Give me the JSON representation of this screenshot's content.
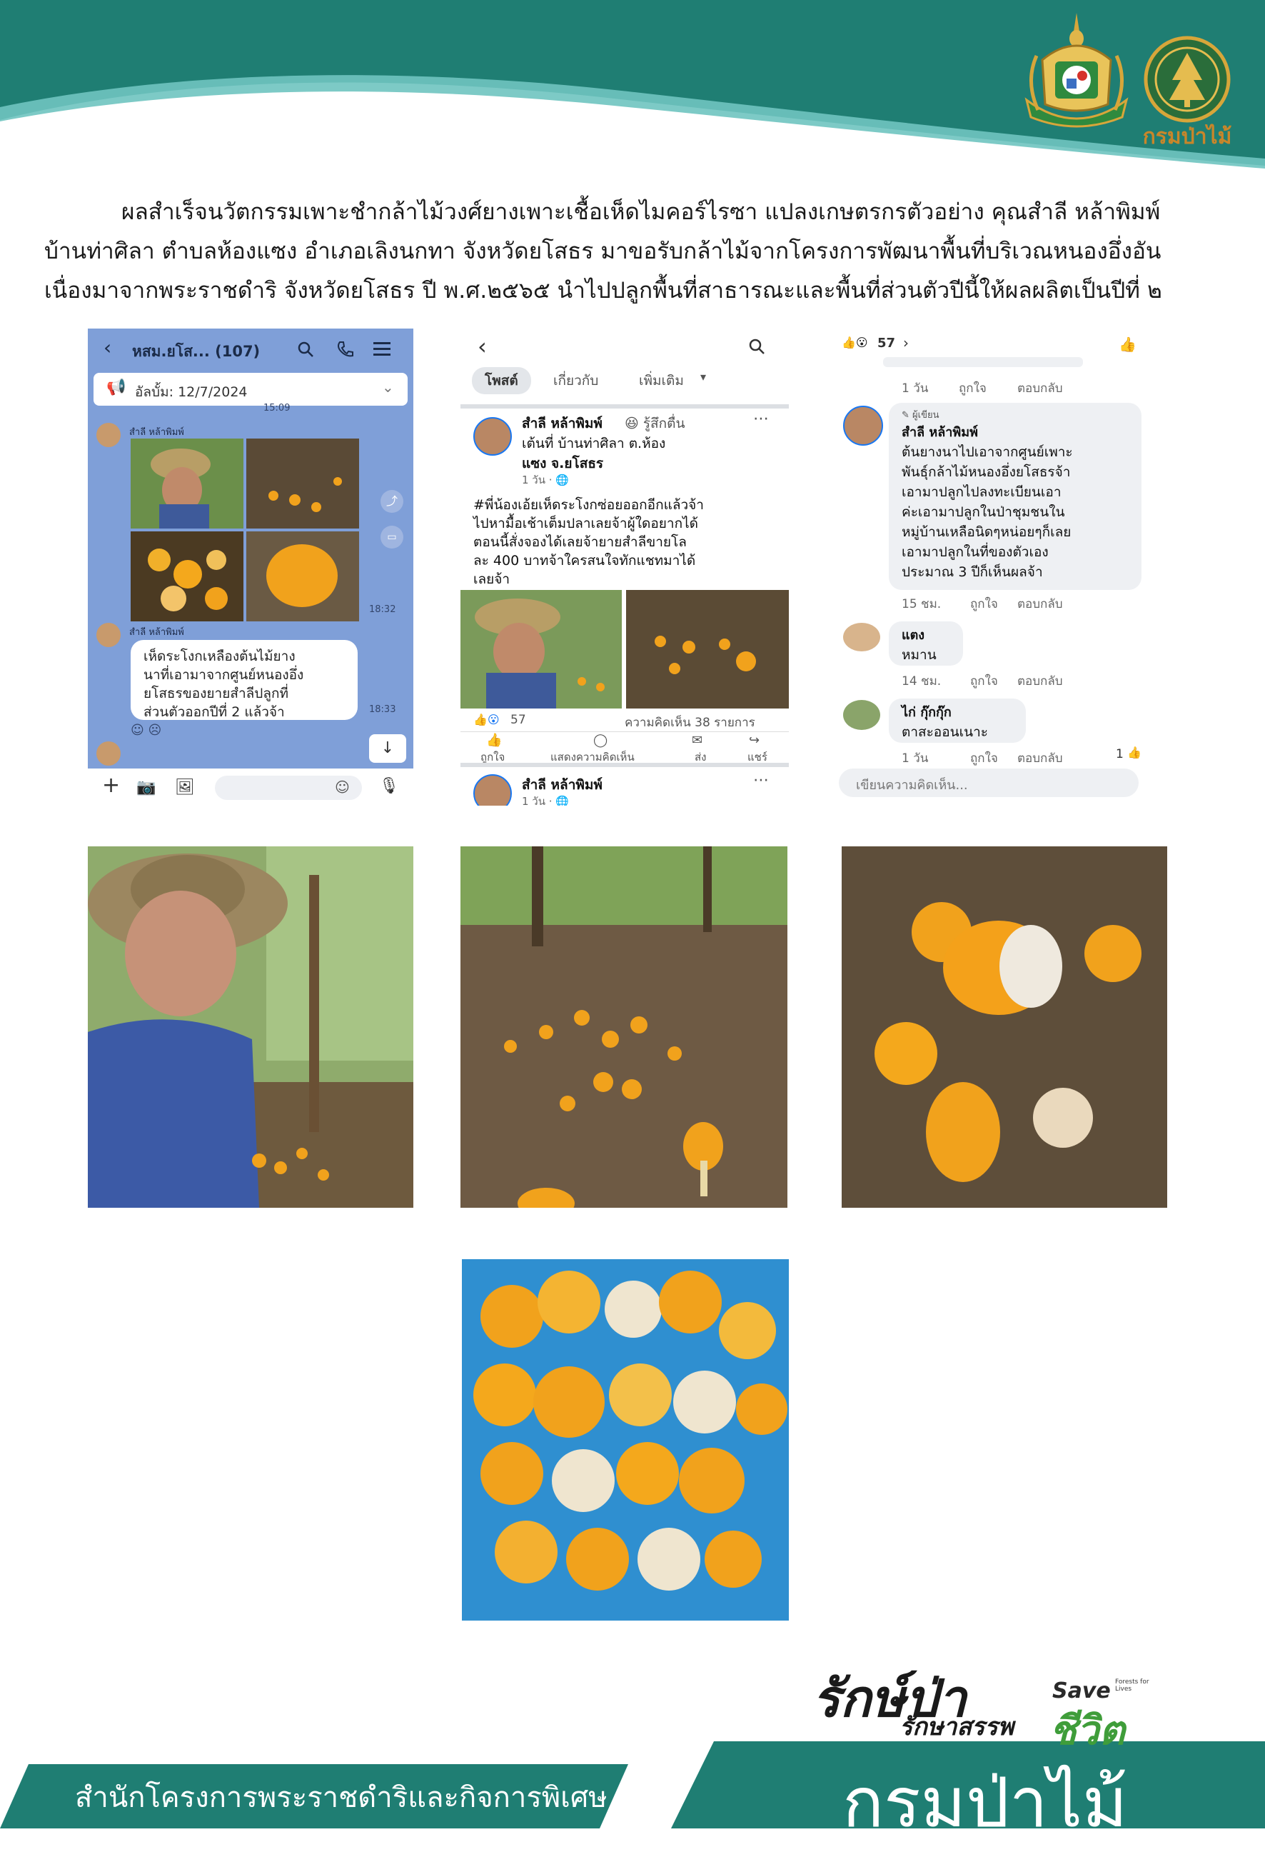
{
  "header": {
    "dept_logo_text": "กรมป่าไม้"
  },
  "intro": {
    "line1": "ผลสำเร็จนวัตกรรมเพาะชำกล้าไม้วงศ์ยางเพาะเชื้อเห็ดไมคอร์ไรซา แปลงเกษตรกรตัวอย่าง คุณสำลี หล้าพิมพ์",
    "line2": "บ้านท่าศิลา ตำบลห้องแซง อำเภอเลิงนกทา จังหวัดยโสธร มาขอรับกล้าไม้จากโครงการพัฒนาพื้นที่บริเวณหนองอึ่งอัน",
    "line3": "เนื่องมาจากพระราชดำริ จังหวัดยโสธร ปี พ.ศ.๒๕๖๕ นำไปปลูกพื้นที่สาธารณะและพื้นที่ส่วนตัวปีนี้ให้ผลผลิตเป็นปีที่ ๒"
  },
  "line_chat": {
    "group_title": "หสม.ยโส... (107)",
    "album": "อัลบั้ม: 12/7/2024",
    "time_top": "15:09",
    "sender": "สำลี หล้าพิมพ์",
    "time_photos": "18:32",
    "message": "เห็ดระโงกเหลืองต้นไม้ยางนาที่เอามาจากศูนย์หนองอึ่งยโสธรของยายสำลีปลูกที่ส่วนตัวออกปีที่ 2 แล้วจ้า",
    "message_lines": [
      "เห็ดระโงกเหลืองต้นไม้ยาง",
      "นาที่เอามาจากศูนย์หนองอึ่ง",
      "ยโสธรของยายสำลีปลูกที่",
      "ส่วนตัวออกปีที่ 2 แล้วจ้า"
    ],
    "time_message": "18:33"
  },
  "fb_post": {
    "tabs": [
      "โพสต์",
      "เกี่ยวกับ",
      "เพิ่มเติม"
    ],
    "author": "สำลี หล้าพิมพ์",
    "feeling_lines": [
      "😆 รู้สึกตื่น",
      "เต้นที่ บ้านท่าศิลา ต.ห้อง",
      "แซง จ.ยโสธร"
    ],
    "time": "1 วัน · 🌐",
    "post_lines": [
      "#พี่น้องเอ้ยเห็ดระโงกซ่อยออกอีกแล้วจ้า",
      "ไปหามื้อเช้าเต็มปลาเลยจ้าผู้ใดอยากได้",
      "ตอนนี้สั่งจองได้เลยจ้ายายสำลีขายโล",
      "ละ 400 บาทจ้าใครสนใจทักแชทมาได้",
      "เลยจ้า"
    ],
    "reactions": "57",
    "comments": "ความคิดเห็น 38 รายการ",
    "actions": [
      "ถูกใจ",
      "แสดงความคิดเห็น",
      "ส่ง",
      "แชร์"
    ],
    "next_author": "สำลี หล้าพิมพ์",
    "next_time": "1 วัน · 🌐"
  },
  "fb_comments": {
    "reaction_count": "57",
    "c0_meta": [
      "1 วัน",
      "ถูกใจ",
      "ตอบกลับ"
    ],
    "author_badge": "ผู้เขียน",
    "c1_name": "สำลี หล้าพิมพ์",
    "c1_lines": [
      "ต้นยางนาไปเอาจากศูนย์เพาะ",
      "พันธุ์กล้าไม้หนองอึ่งยโสธรจ้า",
      "เอามาปลูกไปลงทะเบียนเอา",
      "ค่ะเอามาปลูกในป่าชุมชนใน",
      "หมู่บ้านเหลือนิดๆหน่อยๆก็เลย",
      "เอามาปลูกในที่ของตัวเอง",
      "ประมาณ 3 ปีก็เห็นผลจ้า"
    ],
    "c1_meta": [
      "15 ชม.",
      "ถูกใจ",
      "ตอบกลับ"
    ],
    "c2_name": "แตง",
    "c2_text": "หมาน",
    "c2_meta": [
      "14 ชม.",
      "ถูกใจ",
      "ตอบกลับ"
    ],
    "c3_name": "ไก่ กุ๊กกุ๊ก",
    "c3_text": "ตาสะออนเนาะ",
    "c3_meta": [
      "1 วัน",
      "ถูกใจ",
      "ตอบกลับ"
    ],
    "c3_likes": "1",
    "input_placeholder": "เขียนความคิดเห็น..."
  },
  "footer": {
    "rak_main": "รักษ์ป่า",
    "rak_sub": "รักษาสรรพ",
    "rak_save": "Save",
    "rak_save_small": "Forests for Lives",
    "rak_life": "ชีวิต",
    "office": "สำนักโครงการพระราชดำริและกิจการพิเศษ",
    "dept": "กรมป่าไม้"
  },
  "colors": {
    "teal": "#1f7e73",
    "line_blue": "#7f9fd8",
    "fb_blue": "#1877f2",
    "mushroom_orange": "#f1a21c"
  }
}
